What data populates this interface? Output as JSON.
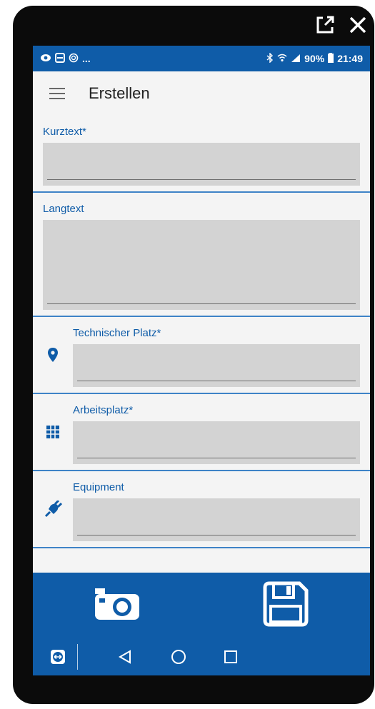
{
  "window_controls": {
    "popout_icon": "external-link-icon",
    "close_icon": "close-icon"
  },
  "status_bar": {
    "left_icons": [
      "eye-icon",
      "teamviewer-icon",
      "camera-lens-icon"
    ],
    "left_more": "...",
    "battery": "90%",
    "time": "21:49"
  },
  "app_bar": {
    "title": "Erstellen"
  },
  "form": {
    "kurztext_label": "Kurztext*",
    "langtext_label": "Langtext",
    "technischer_platz_label": "Technischer Platz*",
    "arbeitsplatz_label": "Arbeitsplatz*",
    "equipment_label": "Equipment"
  },
  "colors": {
    "primary": "#0f5ca8",
    "input_bg": "#d3d3d3",
    "divider": "#3e83c7"
  }
}
